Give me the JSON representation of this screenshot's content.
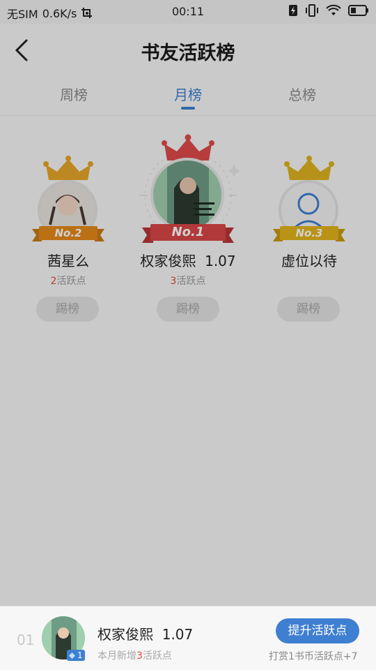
{
  "status_bar": {
    "carrier": "无SIM",
    "speed": "0.6K/s",
    "time": "00:11"
  },
  "header": {
    "title": "书友活跃榜"
  },
  "tabs": [
    {
      "label": "周榜",
      "active": false
    },
    {
      "label": "月榜",
      "active": true
    },
    {
      "label": "总榜",
      "active": false
    }
  ],
  "podium": [
    {
      "rank_badge": "No.1",
      "name": "权家俊熙",
      "level": "1.07",
      "points": "3",
      "points_suffix": "活跃点",
      "kick_label": "踢榜"
    },
    {
      "rank_badge": "No.2",
      "name": "茜星么",
      "level": "",
      "points": "2",
      "points_suffix": "活跃点",
      "kick_label": "踢榜"
    },
    {
      "rank_badge": "No.3",
      "name": "虚位以待",
      "level": "",
      "points": "",
      "points_suffix": "",
      "kick_label": "踢榜"
    }
  ],
  "me": {
    "rank": "01",
    "name": "权家俊熙",
    "level": "1.07",
    "avatar_badge": "1",
    "sub_prefix": "本月新增",
    "sub_points": "3",
    "sub_suffix": "活跃点",
    "boost_label": "提升活跃点",
    "boost_hint": "打赏1书币活跃点+7"
  },
  "colors": {
    "accent": "#3f7fd1",
    "gold": "#e7a72a",
    "red": "#e04a4a",
    "highlight": "#e04a3a"
  }
}
